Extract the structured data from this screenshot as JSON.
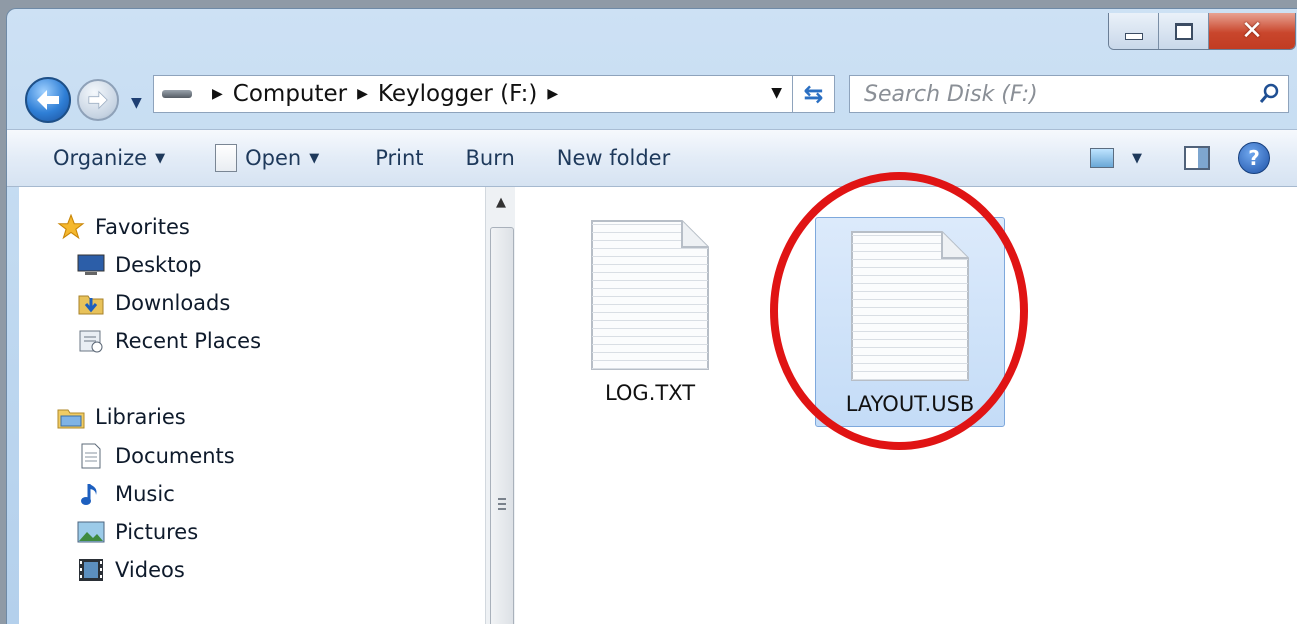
{
  "window": {
    "caption_buttons": {
      "minimize": "minimize",
      "maximize": "maximize",
      "close": "close"
    }
  },
  "address_bar": {
    "breadcrumbs": [
      "Computer",
      "Keylogger (F:)"
    ]
  },
  "search": {
    "placeholder": "Search Disk (F:)"
  },
  "toolbar": {
    "organize": "Organize",
    "open": "Open",
    "print": "Print",
    "burn": "Burn",
    "new_folder": "New folder"
  },
  "nav_pane": {
    "favorites": {
      "label": "Favorites",
      "items": [
        "Desktop",
        "Downloads",
        "Recent Places"
      ]
    },
    "libraries": {
      "label": "Libraries",
      "items": [
        "Documents",
        "Music",
        "Pictures",
        "Videos"
      ]
    }
  },
  "files": [
    {
      "name": "LOG.TXT",
      "selected": false
    },
    {
      "name": "LAYOUT.USB",
      "selected": true
    }
  ],
  "annotation": {
    "circle_color": "#e01414"
  }
}
